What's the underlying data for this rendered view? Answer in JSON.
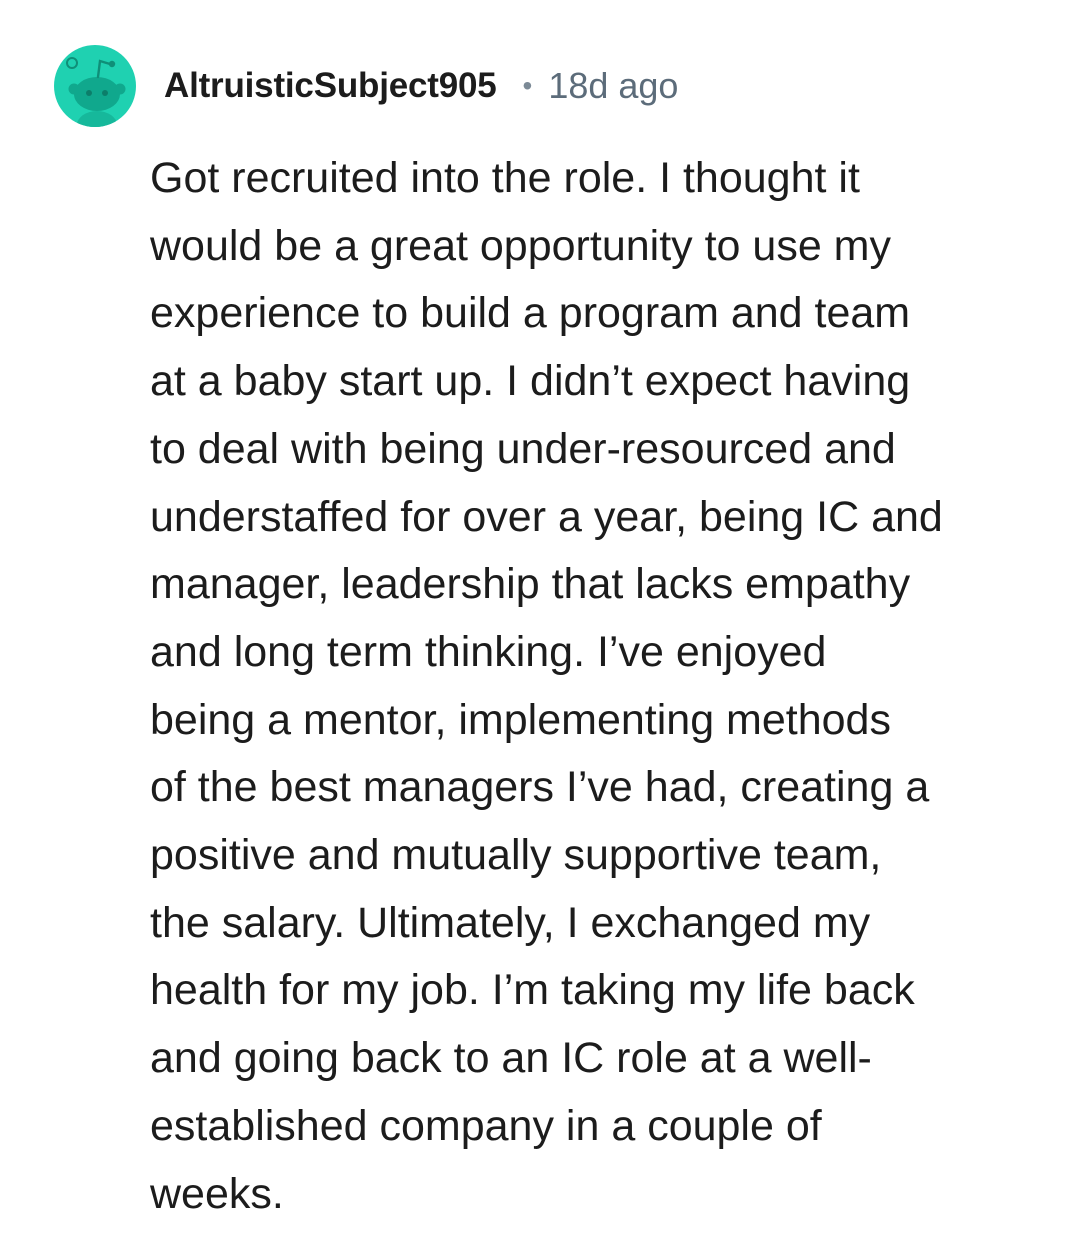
{
  "comment": {
    "author": "AltruisticSubject905",
    "separator": "•",
    "age": "18d ago",
    "avatar_icon": "reddit-snoo-avatar-icon",
    "avatar_color": "#1fd1b1",
    "lines": [
      "Got recruited into the role. I thought it",
      "would be a great opportunity to use my",
      "experience to build a program and team",
      "at a baby start up. I didn’t expect having",
      "to deal with being under-resourced and",
      "understaffed for over a year, being IC and",
      "manager, leadership that lacks empathy",
      "and long term thinking. I’ve enjoyed",
      "being a mentor, implementing methods",
      "of the best managers I’ve had, creating a",
      "positive and mutually supportive team,",
      "the salary. Ultimately, I exchanged my",
      "health for my job. I’m taking my life back",
      "and going back to an IC role at a well-",
      "established company in a couple of",
      "weeks."
    ]
  }
}
